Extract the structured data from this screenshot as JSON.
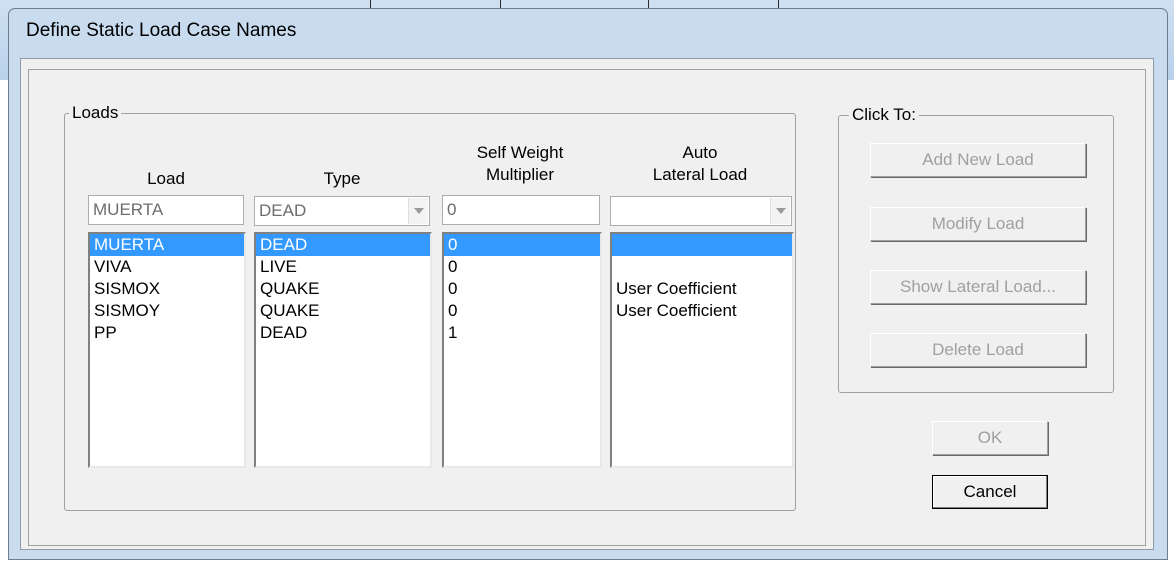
{
  "window": {
    "title": "Define Static Load Case Names"
  },
  "loads_group": {
    "label": "Loads",
    "headers": {
      "load": "Load",
      "type": "Type",
      "self_weight_1": "Self Weight",
      "self_weight_2": "Multiplier",
      "auto_1": "Auto",
      "auto_2": "Lateral Load"
    },
    "edit": {
      "load": "MUERTA",
      "type": "DEAD",
      "multiplier": "0",
      "auto_lateral": ""
    },
    "rows": [
      {
        "load": "MUERTA",
        "type": "DEAD",
        "multiplier": "0",
        "auto": ""
      },
      {
        "load": "VIVA",
        "type": "LIVE",
        "multiplier": "0",
        "auto": ""
      },
      {
        "load": "SISMOX",
        "type": "QUAKE",
        "multiplier": "0",
        "auto": "User Coefficient"
      },
      {
        "load": "SISMOY",
        "type": "QUAKE",
        "multiplier": "0",
        "auto": "User Coefficient"
      },
      {
        "load": "PP",
        "type": "DEAD",
        "multiplier": "1",
        "auto": ""
      }
    ],
    "selected_index": 0
  },
  "click_to_group": {
    "label": "Click To:",
    "add_new_load": "Add New Load",
    "modify_load": "Modify Load",
    "show_lateral_load": "Show Lateral Load...",
    "delete_load": "Delete Load"
  },
  "ok_label": "OK",
  "cancel_label": "Cancel",
  "colors": {
    "selection": "#3399ff",
    "disabled_text": "#a0a0a0",
    "title_bar": "#c9dcef"
  },
  "icons": {
    "combo_arrow": "chevron-down-icon"
  }
}
